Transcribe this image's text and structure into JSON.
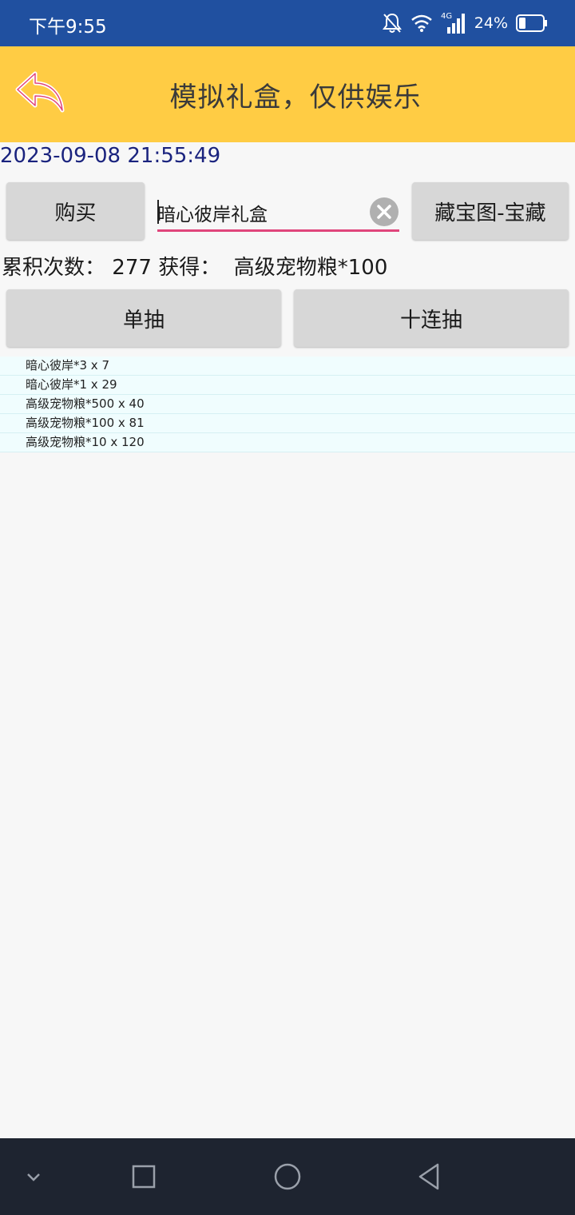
{
  "status": {
    "time": "下午9:55",
    "network": "4G",
    "battery": "24%"
  },
  "header": {
    "title": "模拟礼盒，仅供娱乐"
  },
  "timestamp": "2023-09-08 21:55:49",
  "buttons": {
    "buy": "购买",
    "treasure": "藏宝图-宝藏",
    "single": "单抽",
    "ten": "十连抽"
  },
  "search": {
    "value": "暗心彼岸礼盒"
  },
  "summary": {
    "count_label": "累积次数：",
    "count": "277",
    "gain_label": "获得：",
    "gain": "高级宠物粮*100"
  },
  "results": [
    "暗心彼岸*3 x 7",
    "暗心彼岸*1 x 29",
    "高级宠物粮*500 x 40",
    "高级宠物粮*100 x 81",
    "高级宠物粮*10 x 120"
  ],
  "colors": {
    "header": "#ffcc44",
    "status_bar": "#2050a0",
    "accent_underline": "#e0457b",
    "timestamp": "#1a237e"
  },
  "icons": [
    "mute-bell-icon",
    "wifi-icon",
    "signal-icon",
    "battery-icon",
    "back-arrow-icon",
    "clear-icon",
    "nav-down-icon",
    "recents-icon",
    "home-icon",
    "back-triangle-icon"
  ]
}
